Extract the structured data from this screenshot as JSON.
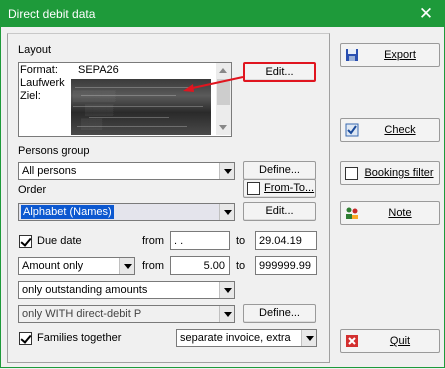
{
  "window": {
    "title": "Direct debit data",
    "close_glyph": "✕"
  },
  "layout": {
    "heading": "Layout",
    "format_label": "Format:",
    "format_value": "SEPA26",
    "laufwerk_label": "Laufwerk",
    "ziel_label": "Ziel:",
    "edit_button": "Edit..."
  },
  "persons_group": {
    "label": "Persons group",
    "value": "All persons",
    "define_button": "Define..."
  },
  "order": {
    "label": "Order",
    "value": "Alphabet (Names)",
    "from_to_label": "From-To...",
    "edit_button": "Edit..."
  },
  "due_date": {
    "label": "Due date",
    "checked": true,
    "from_label": "from",
    "from_value": " .  .",
    "to_label": "to",
    "to_value": "29.04.19"
  },
  "amount": {
    "mode": "Amount only",
    "from_label": "from",
    "from_value": "5.00",
    "to_label": "to",
    "to_value": "999999.99"
  },
  "outstanding": {
    "value": "only outstanding amounts"
  },
  "debit_filter": {
    "value": "only WITH direct-debit P",
    "define_button": "Define..."
  },
  "families": {
    "label": "Families together",
    "checked": true,
    "invoice_mode": "separate invoice, extra"
  },
  "sidebar": {
    "export": "Export",
    "check": "Check",
    "bookings_filter": "Bookings filter",
    "note": "Note",
    "quit": "Quit"
  },
  "colors": {
    "titlebar": "#1e9a3a",
    "selection": "#0c58d0",
    "annotation": "#e0151f"
  }
}
